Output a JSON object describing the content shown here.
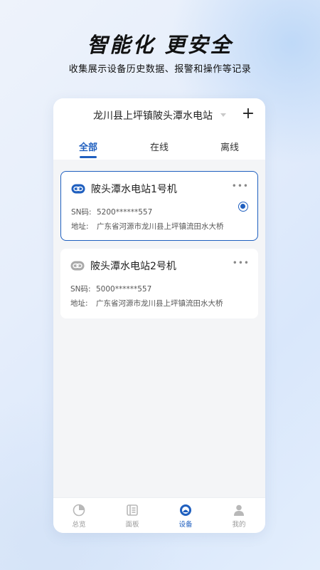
{
  "promo": {
    "headline": "智能化  更安全",
    "subline": "收集展示设备历史数据、报警和操作等记录"
  },
  "header": {
    "station_name": "龙川县上坪镇陂头潭水电站",
    "add_label": "+"
  },
  "tabs": [
    {
      "label": "全部",
      "active": true
    },
    {
      "label": "在线",
      "active": false
    },
    {
      "label": "离线",
      "active": false
    }
  ],
  "devices": [
    {
      "name": "陂头潭水电站1号机",
      "sn_label": "SN码:",
      "sn": "5200******557",
      "addr_label": "地址:",
      "address": "广东省河源市龙川县上坪镇流田水大桥",
      "status": "online",
      "selected": true,
      "more": "•••"
    },
    {
      "name": "陂头潭水电站2号机",
      "sn_label": "SN码:",
      "sn": "5000******557",
      "addr_label": "地址:",
      "address": "广东省河源市龙川县上坪镇流田水大桥",
      "status": "offline",
      "selected": false,
      "more": "•••"
    }
  ],
  "tabbar": [
    {
      "label": "总览",
      "icon": "pie-chart-icon",
      "active": false
    },
    {
      "label": "面板",
      "icon": "panel-icon",
      "active": false
    },
    {
      "label": "设备",
      "icon": "device-icon",
      "active": true
    },
    {
      "label": "我的",
      "icon": "user-icon",
      "active": false
    }
  ],
  "colors": {
    "accent": "#1f5fbf",
    "inactive_icon": "#b8b8b8"
  }
}
